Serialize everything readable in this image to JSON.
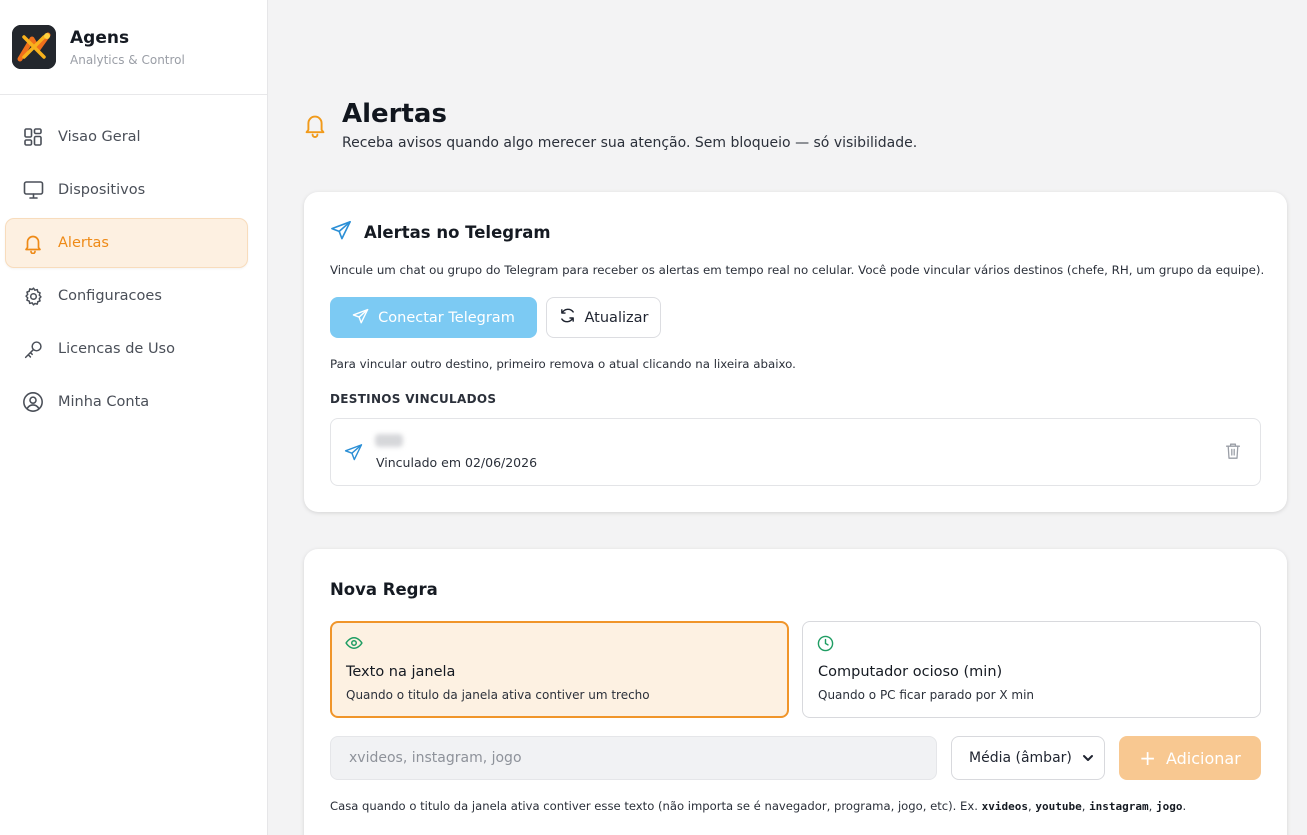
{
  "brand": {
    "name": "Agens",
    "subtitle": "Analytics & Control"
  },
  "sidebar": {
    "items": [
      {
        "label": "Visao Geral",
        "icon": "dashboard-icon",
        "active": false
      },
      {
        "label": "Dispositivos",
        "icon": "monitor-icon",
        "active": false
      },
      {
        "label": "Alertas",
        "icon": "bell-icon",
        "active": true
      },
      {
        "label": "Configuracoes",
        "icon": "gear-icon",
        "active": false
      },
      {
        "label": "Licencas de Uso",
        "icon": "key-icon",
        "active": false
      },
      {
        "label": "Minha Conta",
        "icon": "user-circle-icon",
        "active": false
      }
    ]
  },
  "page": {
    "title": "Alertas",
    "subtitle": "Receba avisos quando algo merecer sua atenção. Sem bloqueio — só visibilidade."
  },
  "telegram": {
    "title": "Alertas no Telegram",
    "description": "Vincule um chat ou grupo do Telegram para receber os alertas em tempo real no celular. Você pode vincular vários destinos (chefe, RH, um grupo da equipe).",
    "connect_label": "Conectar Telegram",
    "refresh_label": "Atualizar",
    "hint": "Para vincular outro destino, primeiro remova o atual clicando na lixeira abaixo.",
    "section_label": "DESTINOS VINCULADOS",
    "destinations": [
      {
        "name": "•••",
        "linked_text": "Vinculado em 02/06/2026"
      }
    ]
  },
  "new_rule": {
    "title": "Nova Regra",
    "options": [
      {
        "title": "Texto na janela",
        "description": "Quando o titulo da janela ativa contiver um trecho",
        "selected": true
      },
      {
        "title": "Computador ocioso (min)",
        "description": "Quando o PC ficar parado por X min",
        "selected": false
      }
    ],
    "input_placeholder": "xvideos, instagram, jogo",
    "input_value": "",
    "severity_selected": "Média (âmbar)",
    "add_label": "Adicionar",
    "help_prefix": "Casa quando o titulo da janela ativa contiver esse texto (não importa se é navegador, programa, jogo, etc). Ex.",
    "help_examples": [
      "xvideos",
      "youtube",
      "instagram",
      "jogo"
    ]
  },
  "colors": {
    "accent": "#ee8a17",
    "telegram_blue": "#7ccaf3",
    "green_icon": "#1f9d63"
  }
}
